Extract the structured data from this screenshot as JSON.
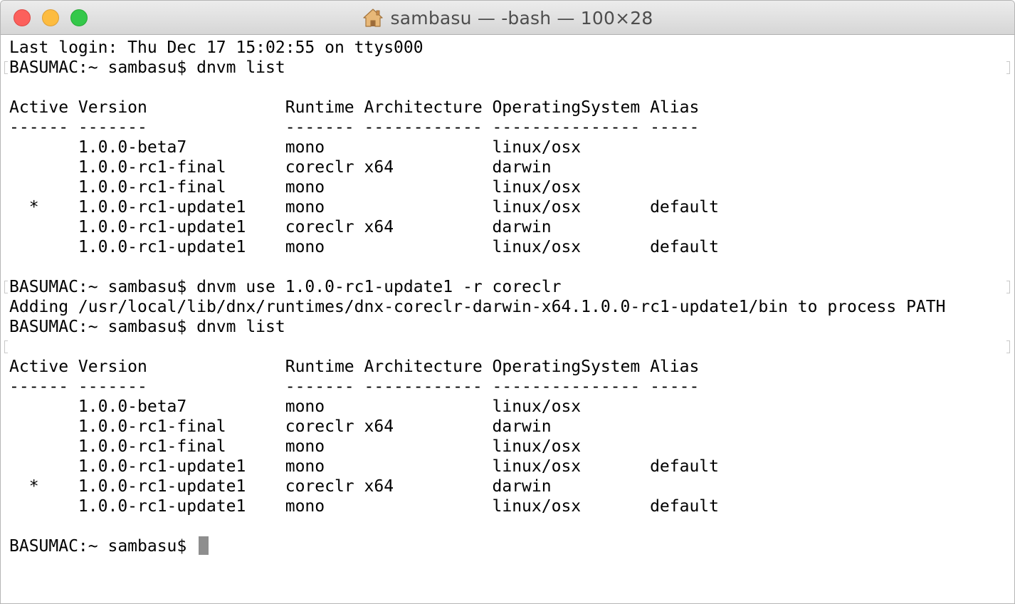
{
  "window": {
    "title": "sambasu — -bash — 100×28",
    "icon": "home-icon",
    "buttons": {
      "close": "close-button",
      "minimize": "minimize-button",
      "zoom": "zoom-button"
    }
  },
  "colors": {
    "close": "#fc605c",
    "minimize": "#fdbc40",
    "zoom": "#34c84a",
    "cursor": "#8e8e8e",
    "text": "#000000"
  },
  "terminal": {
    "lines": [
      "Last login: Thu Dec 17 15:02:55 on ttys000",
      "BASUMAC:~ sambasu$ dnvm list",
      "",
      "Active Version              Runtime Architecture OperatingSystem Alias",
      "------ -------              ------- ------------ --------------- -----",
      "       1.0.0-beta7          mono                 linux/osx",
      "       1.0.0-rc1-final      coreclr x64          darwin",
      "       1.0.0-rc1-final      mono                 linux/osx",
      "  *    1.0.0-rc1-update1    mono                 linux/osx       default",
      "       1.0.0-rc1-update1    coreclr x64          darwin",
      "       1.0.0-rc1-update1    mono                 linux/osx       default",
      "",
      "BASUMAC:~ sambasu$ dnvm use 1.0.0-rc1-update1 -r coreclr",
      "Adding /usr/local/lib/dnx/runtimes/dnx-coreclr-darwin-x64.1.0.0-rc1-update1/bin to process PATH",
      "BASUMAC:~ sambasu$ dnvm list",
      "",
      "Active Version              Runtime Architecture OperatingSystem Alias",
      "------ -------              ------- ------------ --------------- -----",
      "       1.0.0-beta7          mono                 linux/osx",
      "       1.0.0-rc1-final      coreclr x64          darwin",
      "       1.0.0-rc1-final      mono                 linux/osx",
      "       1.0.0-rc1-update1    mono                 linux/osx       default",
      "  *    1.0.0-rc1-update1    coreclr x64          darwin",
      "       1.0.0-rc1-update1    mono                 linux/osx       default",
      "",
      "BASUMAC:~ sambasu$ "
    ]
  }
}
